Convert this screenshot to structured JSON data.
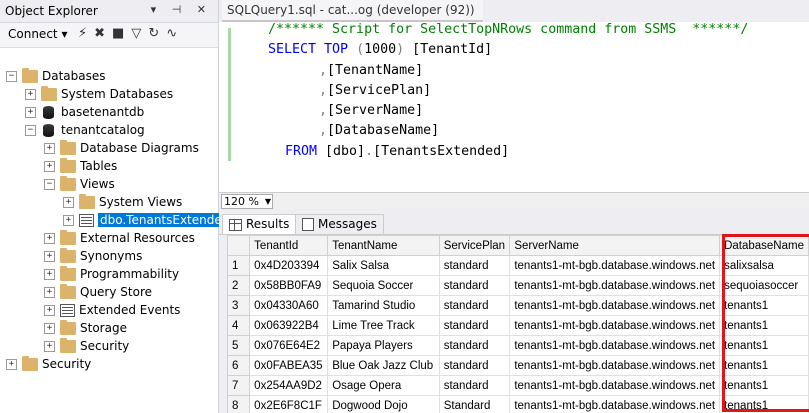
{
  "object_explorer": {
    "title": "Object Explorer",
    "title_controls": "▾ ⊣ ✕",
    "toolbar": {
      "connect_label": "Connect",
      "connect_arrow": "▾"
    },
    "tree": [
      {
        "label": "Databases",
        "expander": "−"
      },
      {
        "label": "System Databases",
        "expander": "+"
      },
      {
        "label": "basetenantdb",
        "expander": "+"
      },
      {
        "label": "tenantcatalog",
        "expander": "−"
      },
      {
        "label": "Database Diagrams",
        "expander": "+"
      },
      {
        "label": "Tables",
        "expander": "+"
      },
      {
        "label": "Views",
        "expander": "−"
      },
      {
        "label": "System Views",
        "expander": "+"
      },
      {
        "label": "dbo.TenantsExtended",
        "expander": "+"
      },
      {
        "label": "External Resources",
        "expander": "+"
      },
      {
        "label": "Synonyms",
        "expander": "+"
      },
      {
        "label": "Programmability",
        "expander": "+"
      },
      {
        "label": "Query Store",
        "expander": "+"
      },
      {
        "label": "Extended Events",
        "expander": "+"
      },
      {
        "label": "Storage",
        "expander": "+"
      },
      {
        "label": "Security",
        "expander": "+"
      },
      {
        "label": "Security",
        "expander": "+"
      }
    ]
  },
  "editor": {
    "tab_label": "SQLQuery1.sql - cat...og (developer (92))",
    "lines": [
      "/****** Script for SelectTopNRows command from SSMS  ******/",
      "SELECT TOP (1000) [TenantId]",
      ",[TenantName]",
      ",[ServicePlan]",
      ",[ServerName]",
      ",[DatabaseName]",
      "FROM [dbo].[TenantsExtended]"
    ],
    "zoom": "120 %"
  },
  "results": {
    "tabs": [
      "Results",
      "Messages"
    ],
    "columns": [
      "",
      "TenantId",
      "TenantName",
      "ServicePlan",
      "ServerName",
      "DatabaseName"
    ],
    "rows": [
      [
        "1",
        "0x4D203394",
        "Salix Salsa",
        "standard",
        "tenants1-mt-bgb.database.windows.net",
        "salixsalsa"
      ],
      [
        "2",
        "0x58BB0FA9",
        "Sequoia Soccer",
        "standard",
        "tenants1-mt-bgb.database.windows.net",
        "sequoiasoccer"
      ],
      [
        "3",
        "0x04330A60",
        "Tamarind Studio",
        "standard",
        "tenants1-mt-bgb.database.windows.net",
        "tenants1"
      ],
      [
        "4",
        "0x063922B4",
        "Lime Tree Track",
        "standard",
        "tenants1-mt-bgb.database.windows.net",
        "tenants1"
      ],
      [
        "5",
        "0x076E64E2",
        "Papaya Players",
        "standard",
        "tenants1-mt-bgb.database.windows.net",
        "tenants1"
      ],
      [
        "6",
        "0x0FABEA35",
        "Blue Oak Jazz Club",
        "standard",
        "tenants1-mt-bgb.database.windows.net",
        "tenants1"
      ],
      [
        "7",
        "0x254AA9D2",
        "Osage Opera",
        "standard",
        "tenants1-mt-bgb.database.windows.net",
        "tenants1"
      ],
      [
        "8",
        "0x2E6F8C1F",
        "Dogwood Dojo",
        "Standard",
        "tenants1-mt-bgb.database.windows.net",
        "tenants1"
      ]
    ]
  },
  "colors": {
    "highlight": "#e0161b",
    "selection": "#0078d7",
    "keyword": "#0000ff",
    "comment": "#008000"
  }
}
